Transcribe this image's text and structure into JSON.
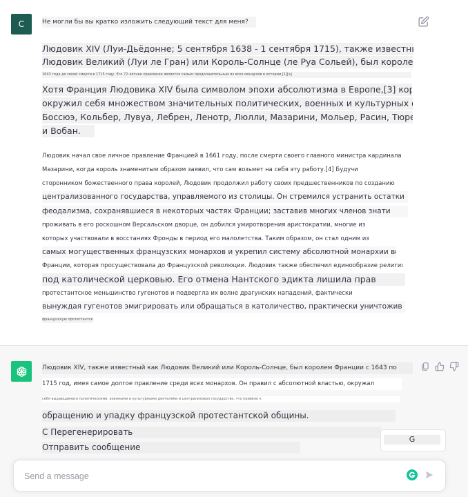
{
  "user": {
    "avatar_letter": "C",
    "prompt": "Не могли бы вы кратко изложить следующий текст для меня?",
    "lines": [
      "Людовик XIV (Луи-Дьёдонне; 5 сентября 1638 - 1 сентября 1715), также известный как",
      " Людовик Великий (Луи ле Гран) или Король-Солнце (ле Руа Сольей), был королем Франции с",
      "1643 года до своей смерти в 1715 году. Его 72-летнее правление является самым продолжительным из всех монархов в истории.[1][a]",
      "Хотя Франция Людовика XIV была символом эпохи абсолютизма в Европе,[3] король",
      "окружил себя множеством значительных политических, военных и культурных фигур, таких как",
      "Боссюэ, Кольбер, Лувуа, Лебрен, Ленотр, Люлли, Мазарини, Мольер, Расин, Тюренн, Конде",
      "и Вобан.",
      "Людовик начал свое личное правление Францией в 1661 году, после смерти своего главного министра кардинала",
      "Мазарини, когда король знаменитым образом заявил, что сам возьмет на себя эту работу.[4] Будучи",
      "сторонником божественного права королей, Людовик продолжил работу своих предшественников по созданию",
      "централизованного государства, управляемого из столицы. Он стремился устранить остатки",
      "феодализма, сохранявшиеся в некоторых частях Франции; заставив многих членов знати",
      "проживать в его роскошном Версальском дворце, он добился умиротворения аристократии, многие из",
      "которых участвовали в восстаниях Фронды в период его малолетства. Таким образом, он стал одним из",
      "самых могущественных французских монархов и укрепил систему абсолютной монархии во",
      "Франции, которая просуществовала до Французской революции. Людовик также обеспечил единообразие религии",
      "под католической церковью. Его отмена Нантского эдикта лишила прав",
      "протестантское меньшинство гугенотов и подвергла их волне драгунских нападений, фактически",
      "вынуждая гугенотов эмигрировать или обращаться в католичество, практически уничтожив",
      "французскую протестантскую общину."
    ]
  },
  "assistant": {
    "lines": [
      "Людовик XIV, также известный как Людовик Великий или Король-Солнце, был королем Франции с 1643 по",
      "1715 год, имея самое долгое правление среди всех монархов. Он правил с абсолютной властью, окружал",
      "себя выдающимися политическими, военными и культурными деятелями и централизовал государство, что привело к",
      "обращению и упадку французской протестантской общины.",
      "С Перегенерировать",
      "Отправить сообщение"
    ],
    "regenerate_label": "G"
  },
  "composer": {
    "placeholder": "Send a message"
  },
  "icons": {
    "edit": "edit-icon",
    "copy": "copy-icon",
    "thumbs_up": "thumbs-up-icon",
    "thumbs_down": "thumbs-down-icon",
    "grammarly": "grammarly-icon",
    "send": "send-icon"
  },
  "colors": {
    "user_avatar": "#1e5c52",
    "assistant_avatar": "#19c37d",
    "assistant_bg": "#f7f7f8",
    "grammarly": "#15c39a"
  }
}
